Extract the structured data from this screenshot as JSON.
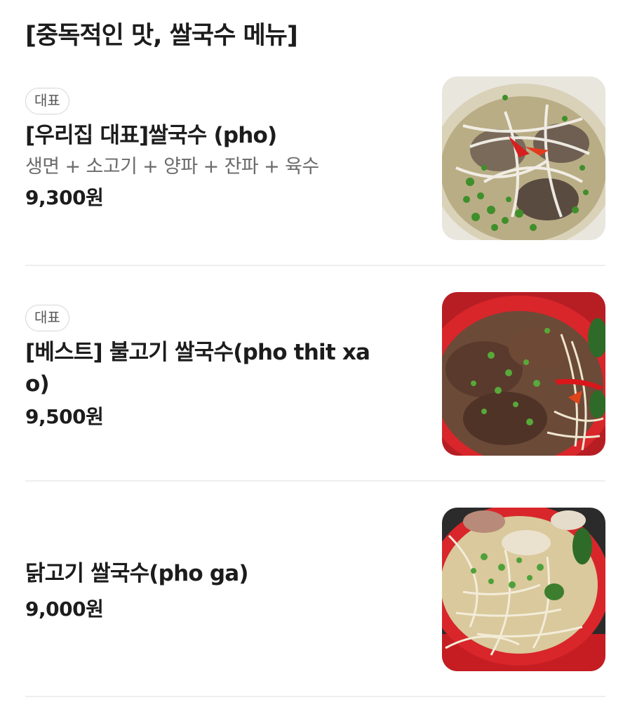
{
  "section": {
    "title": "[중독적인 맛, 쌀국수 메뉴]"
  },
  "items": [
    {
      "badge": "대표",
      "name": "[우리집 대표]쌀국수 (pho)",
      "description": "생면 + 소고기 + 양파 + 잔파 + 육수",
      "price": "9,300원",
      "image_icon": "pho-beef-photo"
    },
    {
      "badge": "대표",
      "name_line1": "[베스트] 불고기 쌀국수(pho thit xa",
      "name_line2": "o)",
      "price": "9,500원",
      "image_icon": "pho-bulgogi-photo"
    },
    {
      "name": "닭고기 쌀국수(pho ga)",
      "price": "9,000원",
      "image_icon": "pho-chicken-photo"
    }
  ],
  "colors": {
    "text": "#1c1c1c",
    "muted": "#6b6b6b",
    "divider": "#eeeeee",
    "bowl_red": "#d8262b"
  }
}
